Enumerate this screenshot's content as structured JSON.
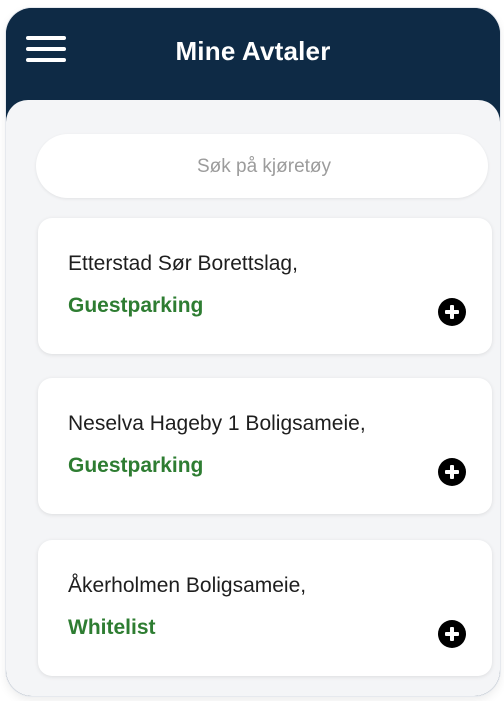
{
  "header": {
    "title": "Mine Avtaler",
    "menu_icon": "hamburger-menu-icon"
  },
  "search": {
    "placeholder": "Søk på kjøretøy"
  },
  "agreements": [
    {
      "name": "Etterstad Sør Borettslag,",
      "type": "Guestparking",
      "action_icon": "plus-circle-icon"
    },
    {
      "name": "Neselva Hageby 1 Boligsameie,",
      "type": "Guestparking",
      "action_icon": "plus-circle-icon"
    },
    {
      "name": "Åkerholmen Boligsameie,",
      "type": "Whitelist",
      "action_icon": "plus-circle-icon"
    }
  ],
  "colors": {
    "header_bg": "#0e2a45",
    "content_bg": "#f4f5f7",
    "type_text": "#2e7d32",
    "add_button": "#000000"
  }
}
